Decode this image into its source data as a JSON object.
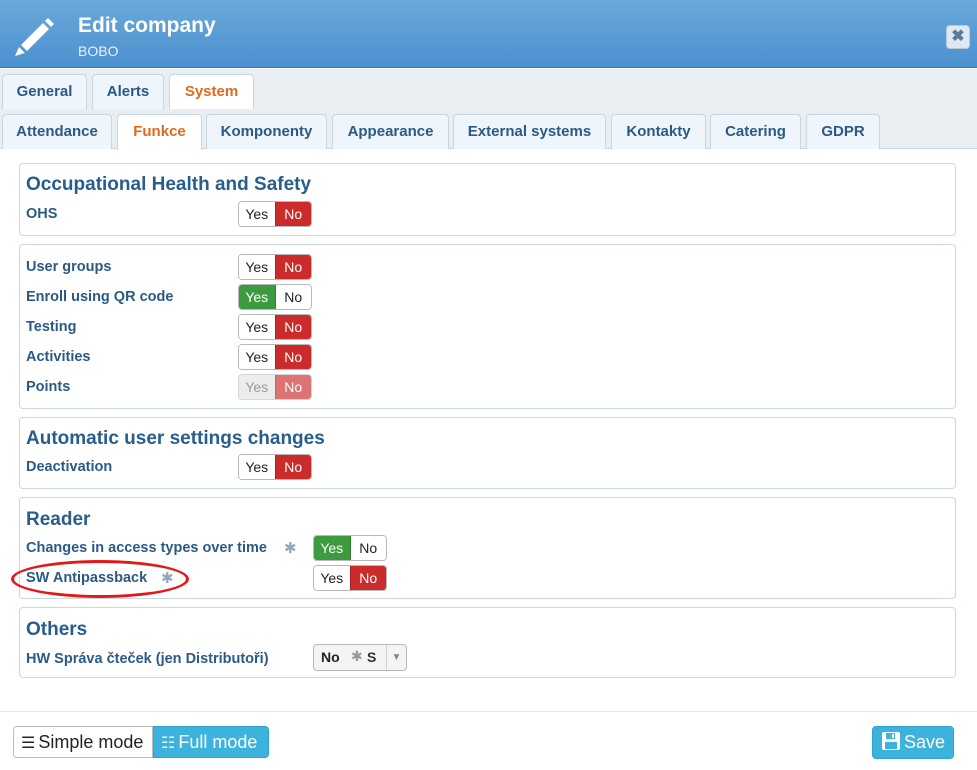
{
  "dialog": {
    "title": "Edit company",
    "subtitle": "BOBO",
    "close_glyph": "✖"
  },
  "tabs_row1": [
    {
      "label": "General",
      "active": false
    },
    {
      "label": "Alerts",
      "active": false
    },
    {
      "label": "System",
      "active": true
    }
  ],
  "tabs_row2": [
    {
      "label": "Attendance",
      "active": false
    },
    {
      "label": "Funkce",
      "active": true
    },
    {
      "label": "Komponenty",
      "active": false
    },
    {
      "label": "Appearance",
      "active": false
    },
    {
      "label": "External systems",
      "active": false
    },
    {
      "label": "Kontakty",
      "active": false
    },
    {
      "label": "Catering",
      "active": false
    },
    {
      "label": "GDPR",
      "active": false
    }
  ],
  "toggle_labels": {
    "yes": "Yes",
    "no": "No"
  },
  "ohs": {
    "title": "Occupational Health and Safety",
    "rows": [
      {
        "label": "OHS",
        "value": "No"
      }
    ]
  },
  "general": {
    "rows": [
      {
        "label": "User groups",
        "value": "No"
      },
      {
        "label": "Enroll using QR code",
        "value": "Yes"
      },
      {
        "label": "Testing",
        "value": "No"
      },
      {
        "label": "Activities",
        "value": "No"
      },
      {
        "label": "Points",
        "value": "No",
        "disabled": true
      }
    ]
  },
  "auto": {
    "title": "Automatic user settings changes",
    "rows": [
      {
        "label": "Deactivation",
        "value": "No"
      }
    ]
  },
  "reader": {
    "title": "Reader",
    "rows": [
      {
        "label": "Changes in access types over time",
        "value": "Yes",
        "has_gear": true
      },
      {
        "label": "SW Antipassback",
        "value": "No",
        "has_gear": true,
        "highlighted": true
      }
    ]
  },
  "others": {
    "title": "Others",
    "rows": [
      {
        "label": "HW Správa čteček (jen Distributoři)",
        "select_value": "No",
        "select_suffix": "S"
      }
    ]
  },
  "footer": {
    "simple_mode_label": "Simple mode",
    "full_mode_label": "Full mode",
    "active_mode": "Full mode",
    "save_label": "Save"
  },
  "colors": {
    "header": "#4b90cf",
    "active_tab_text": "#e06a1d",
    "toggle_no_on": "#cc2b2b",
    "toggle_yes_on": "#3e9a3e",
    "primary_button": "#3cb3dc",
    "highlight_ellipse": "#e31818"
  }
}
